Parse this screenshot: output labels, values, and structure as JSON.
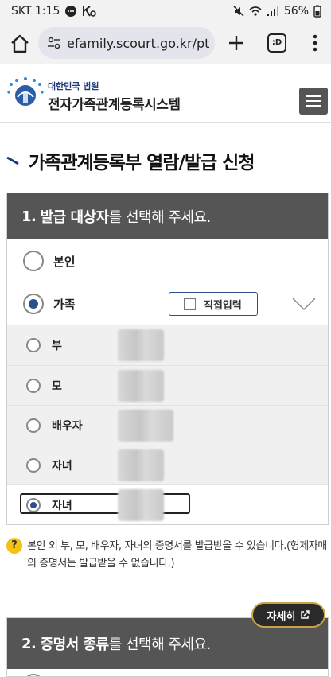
{
  "status_bar": {
    "carrier_time": "SKT 1:15",
    "battery": "56%"
  },
  "browser": {
    "url": "efamily.scourt.go.kr/pt",
    "tabs_label": ":D"
  },
  "site": {
    "logo_small": "대한민국 법원",
    "logo_main": "전자가족관계등록시스템"
  },
  "page_title": "가족관계등록부 열람/발급 신청",
  "section1": {
    "number": "1.",
    "heading_bold": "발급 대상자",
    "heading_rest": "를 선택해 주세요.",
    "options": [
      {
        "label": "본인",
        "selected": false
      },
      {
        "label": "가족",
        "selected": true
      }
    ],
    "direct_input_label": "직접입력",
    "family_members": [
      {
        "label": "부",
        "selected": false
      },
      {
        "label": "모",
        "selected": false
      },
      {
        "label": "배우자",
        "selected": false
      },
      {
        "label": "자녀",
        "selected": false
      },
      {
        "label": "자녀",
        "selected": true
      }
    ]
  },
  "notice": {
    "icon": "?",
    "text": "본인 외 부, 모, 배우자, 자녀의 증명서를 발급받을 수 있습니다.(형제자매의 증명서는 발급받을 수 없습니다.)"
  },
  "detail_button": "자세히",
  "section2": {
    "number": "2.",
    "heading_bold": "증명서 종류",
    "heading_rest": "를 선택해 주세요."
  }
}
